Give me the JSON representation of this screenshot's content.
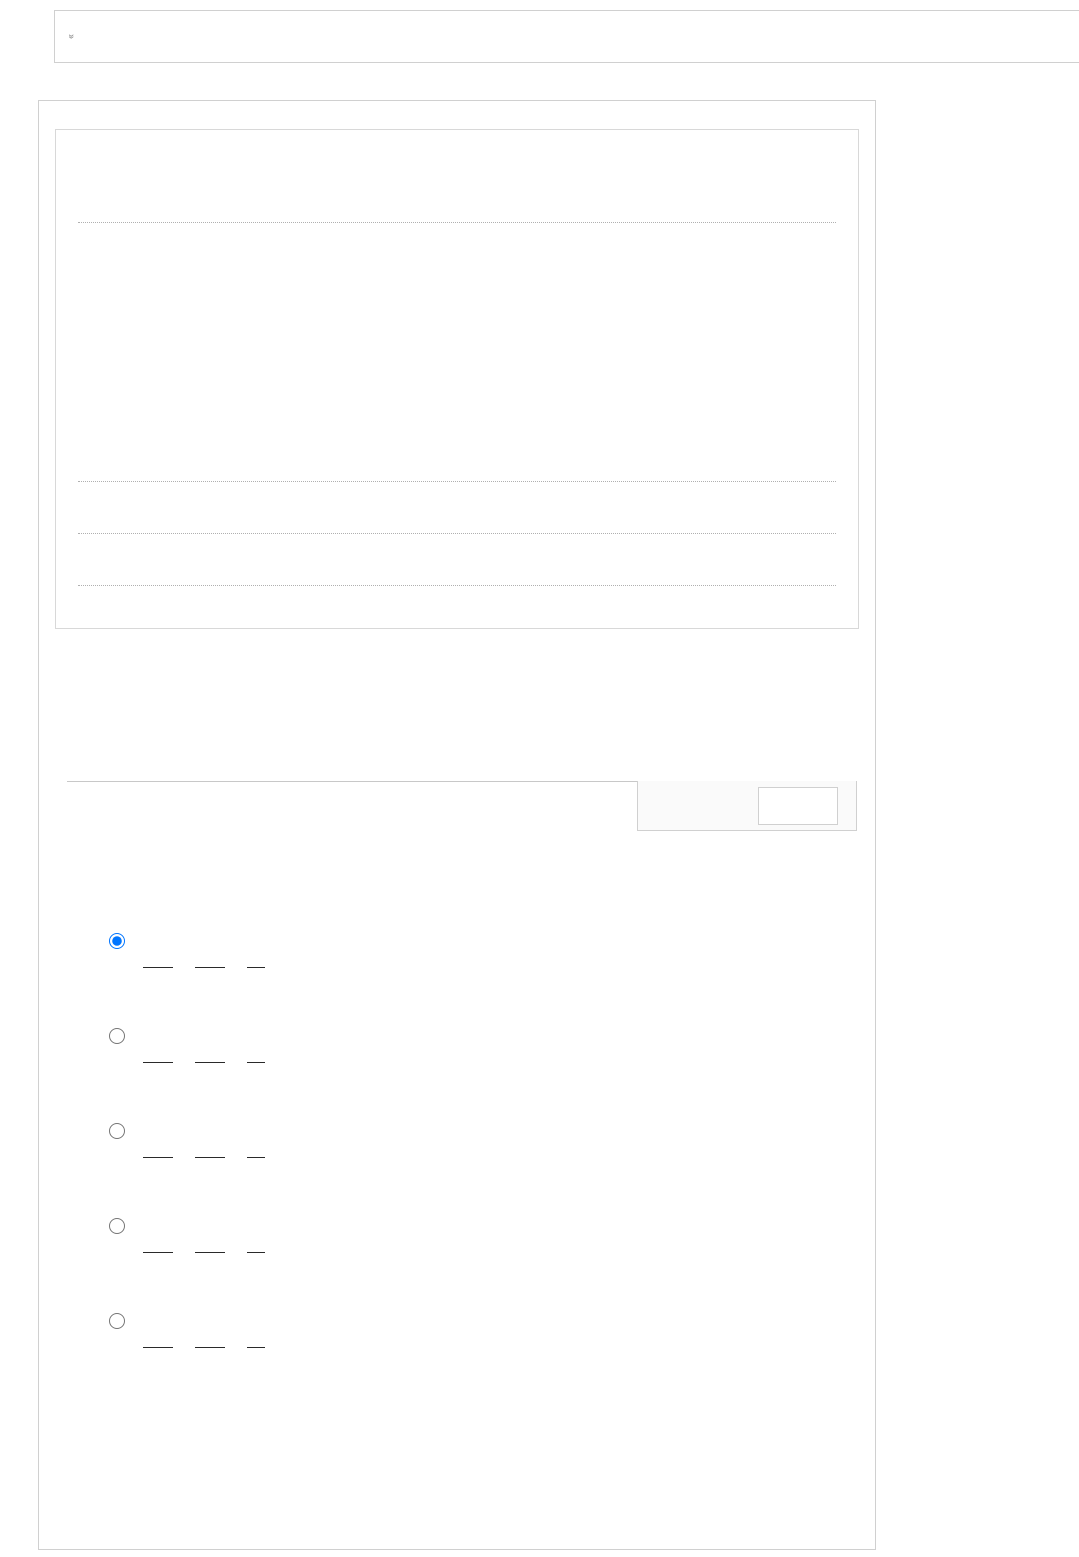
{
  "topbar": {
    "expand_icon": "chevron-double-down"
  },
  "inner_box": {
    "rows": [
      {
        "label": ""
      },
      {
        "label": ""
      },
      {
        "label": ""
      },
      {
        "label": ""
      }
    ]
  },
  "recaptcha": {
    "present": true
  },
  "options": [
    {
      "selected": true,
      "label": "",
      "dashes": [
        "long",
        "long",
        "short"
      ]
    },
    {
      "selected": false,
      "label": "",
      "dashes": [
        "long",
        "long",
        "short"
      ]
    },
    {
      "selected": false,
      "label": "",
      "dashes": [
        "long",
        "long",
        "short"
      ]
    },
    {
      "selected": false,
      "label": "",
      "dashes": [
        "long",
        "long",
        "short"
      ]
    },
    {
      "selected": false,
      "label": "",
      "dashes": [
        "long",
        "long",
        "short"
      ]
    }
  ]
}
